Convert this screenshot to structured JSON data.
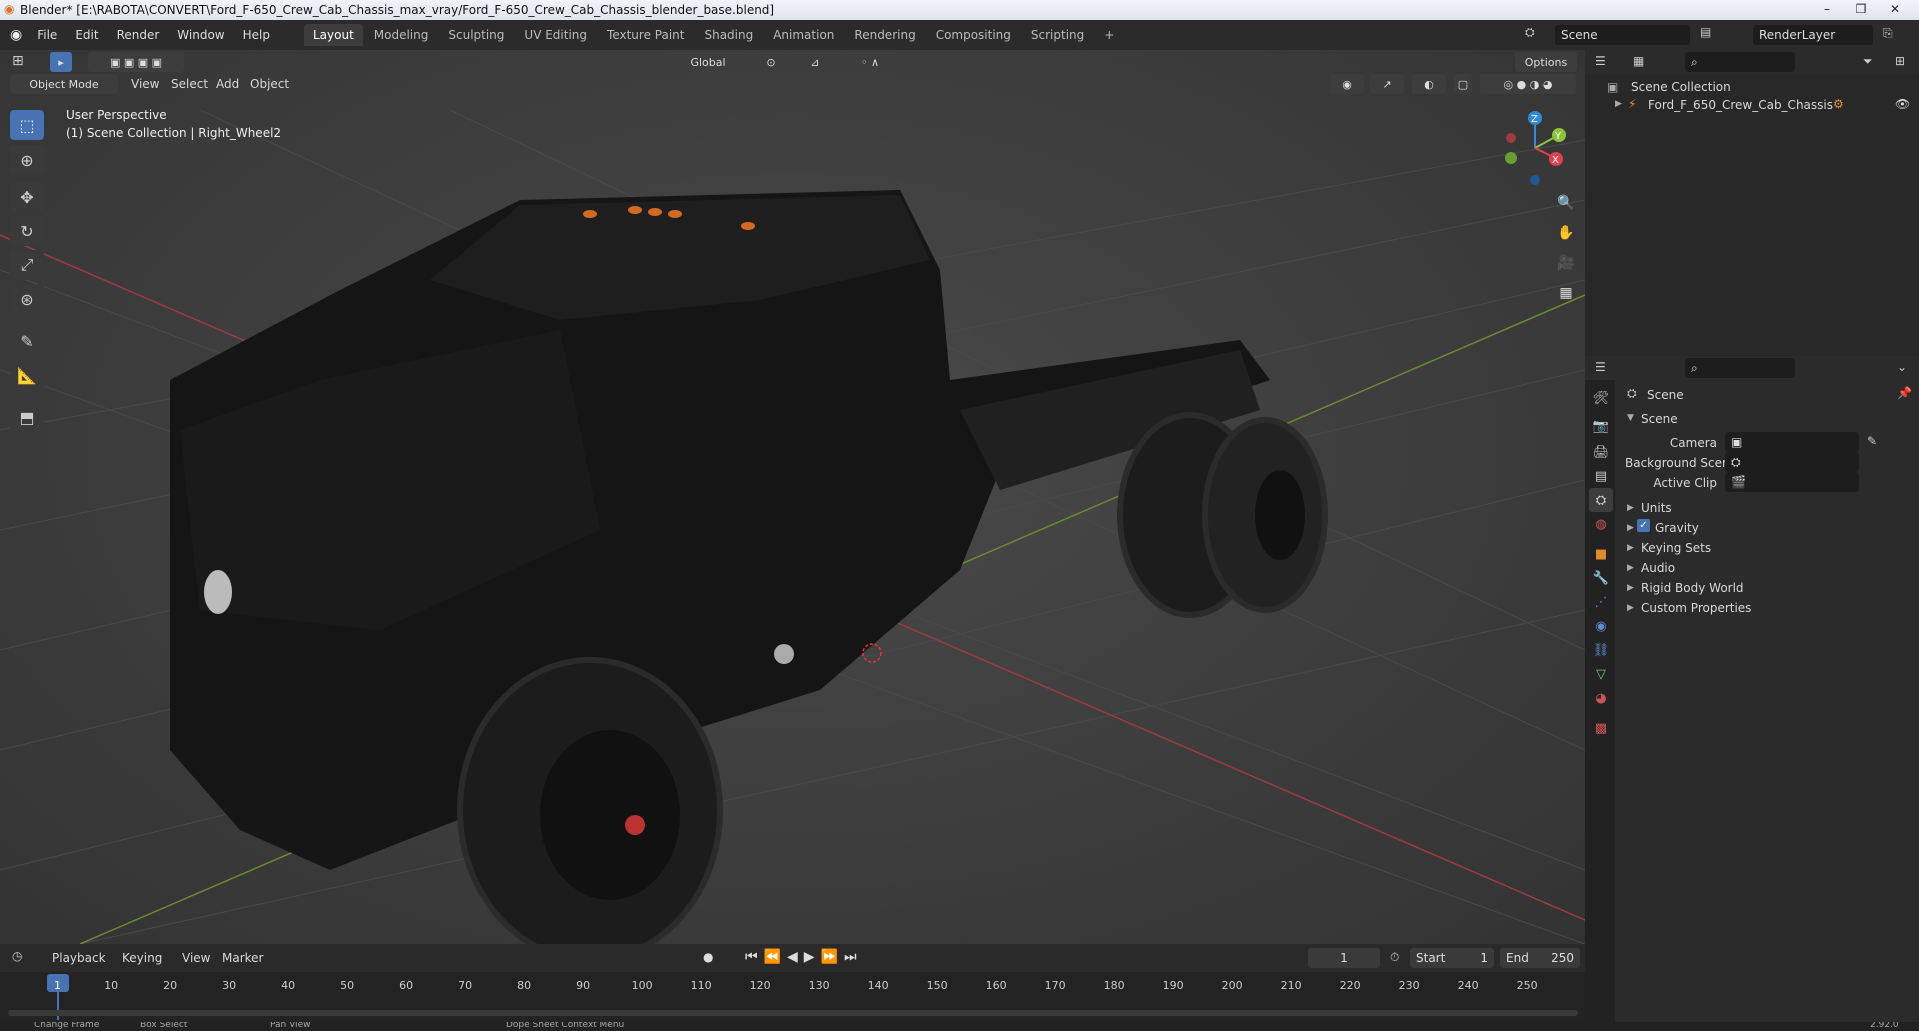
{
  "window": {
    "title": "Blender* [E:\\RABOTA\\CONVERT\\Ford_F-650_Crew_Cab_Chassis_max_vray/Ford_F-650_Crew_Cab_Chassis_blender_base.blend]",
    "minimize": "–",
    "maximize": "❐",
    "close": "✕"
  },
  "menu": {
    "file": "File",
    "edit": "Edit",
    "render": "Render",
    "window": "Window",
    "help": "Help"
  },
  "workspaces": [
    "Layout",
    "Modeling",
    "Sculpting",
    "UV Editing",
    "Texture Paint",
    "Shading",
    "Animation",
    "Rendering",
    "Compositing",
    "Scripting"
  ],
  "add_workspace": "+",
  "scene_selector": {
    "value": "Scene"
  },
  "renderlayer_selector": {
    "value": "RenderLayer"
  },
  "viewport_header": {
    "orientation": "Global",
    "options": "Options",
    "mode": "Object Mode",
    "view": "View",
    "select": "Select",
    "add": "Add",
    "object": "Object"
  },
  "viewport_info": {
    "perspective": "User Perspective",
    "context": "(1) Scene Collection | Right_Wheel2"
  },
  "gizmo": {
    "x": "X",
    "y": "Y",
    "z": "Z"
  },
  "outliner": {
    "root": "Scene Collection",
    "items": [
      {
        "label": "Ford_F_650_Crew_Cab_Chassis"
      }
    ]
  },
  "properties": {
    "breadcrumb": "Scene",
    "section": "Scene",
    "fields": [
      {
        "label": "Camera",
        "value": ""
      },
      {
        "label": "Background Scene",
        "value": ""
      },
      {
        "label": "Active Clip",
        "value": ""
      }
    ],
    "panels": [
      "Units",
      "Gravity",
      "Keying Sets",
      "Audio",
      "Rigid Body World",
      "Custom Properties"
    ],
    "gravity_checked": true
  },
  "timeline": {
    "playback": "Playback",
    "keying": "Keying",
    "view": "View",
    "marker": "Marker",
    "current_frame": "1",
    "start_label": "Start",
    "start": "1",
    "end_label": "End",
    "end": "250",
    "ticks": [
      "1",
      "10",
      "20",
      "30",
      "40",
      "50",
      "60",
      "70",
      "80",
      "90",
      "100",
      "110",
      "120",
      "130",
      "140",
      "150",
      "160",
      "170",
      "180",
      "190",
      "200",
      "210",
      "220",
      "230",
      "240",
      "250"
    ]
  },
  "status": {
    "a": "Change Frame",
    "b": "Box Select",
    "c": "Pan View",
    "d": "Dope Sheet Context Menu",
    "version": "2.92.0"
  },
  "colors": {
    "accent": "#4772b3",
    "x_axis": "#e0424d",
    "y_axis": "#8bc43a",
    "z_axis": "#2f8ad8",
    "active_tab": "#3d3d3d"
  }
}
